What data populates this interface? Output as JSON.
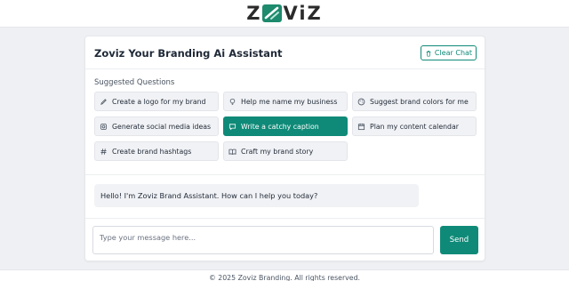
{
  "brand": {
    "logo_left": "Z",
    "logo_right": "ViZ",
    "accent": "#0f8a78"
  },
  "header": {
    "title": "Zoviz Your Branding Ai Assistant",
    "clear_label": "Clear Chat"
  },
  "suggestions": {
    "label": "Suggested Questions",
    "items": [
      {
        "label": "Create a logo for my brand",
        "icon": "pencil-icon",
        "active": false
      },
      {
        "label": "Help me name my business",
        "icon": "lightbulb-icon",
        "active": false
      },
      {
        "label": "Suggest brand colors for me",
        "icon": "palette-icon",
        "active": false
      },
      {
        "label": "Generate social media ideas",
        "icon": "instagram-icon",
        "active": false
      },
      {
        "label": "Write a catchy caption",
        "icon": "chat-icon",
        "active": true
      },
      {
        "label": "Plan my content calendar",
        "icon": "calendar-icon",
        "active": false
      },
      {
        "label": "Create brand hashtags",
        "icon": "hashtag-icon",
        "active": false
      },
      {
        "label": "Craft my brand story",
        "icon": "book-icon",
        "active": false
      }
    ]
  },
  "chat": {
    "assistant_message": "Hello! I'm Zoviz Brand Assistant. How can I help you today?",
    "input_placeholder": "Type your message here...",
    "input_value": "",
    "send_label": "Send"
  },
  "footer": {
    "text": "© 2025 Zoviz Branding. All rights reserved."
  }
}
